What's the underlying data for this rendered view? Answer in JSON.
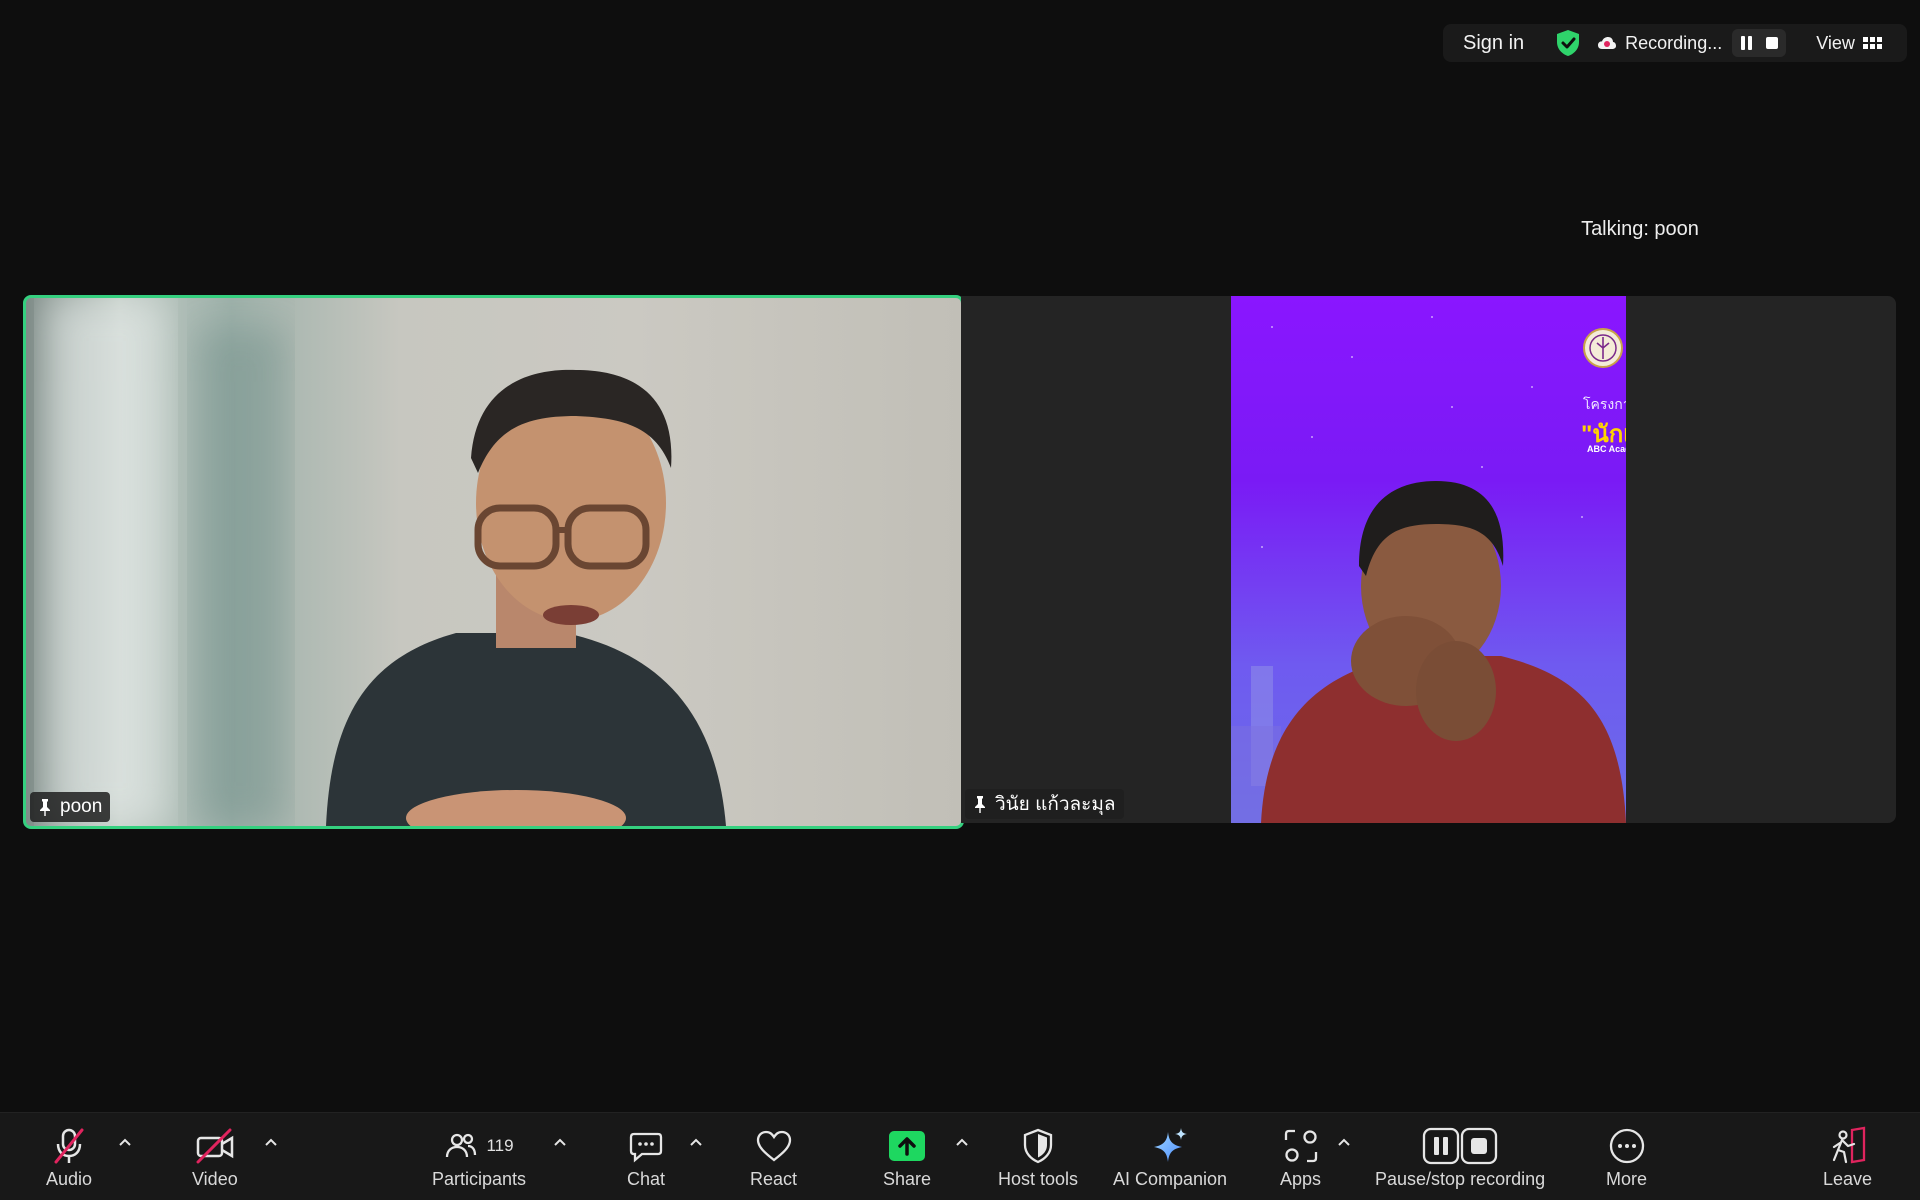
{
  "topbar": {
    "sign_in": "Sign in",
    "recording_label": "Recording...",
    "view_label": "View"
  },
  "talking": "Talking: poon",
  "participants_tiles": [
    {
      "name": "poon",
      "active_speaker": true
    },
    {
      "name": "วินัย แก้วละมุล",
      "active_speaker": false
    }
  ],
  "right_video_overlay": {
    "line1": "โครงกา",
    "line2": "\"นักเ",
    "line3": "ABC Acad"
  },
  "toolbar": {
    "audio": "Audio",
    "video": "Video",
    "participants": "Participants",
    "participant_count": "119",
    "chat": "Chat",
    "react": "React",
    "share": "Share",
    "host_tools": "Host tools",
    "ai_companion": "AI Companion",
    "apps": "Apps",
    "pause_stop": "Pause/stop recording",
    "more": "More",
    "leave": "Leave"
  },
  "colors": {
    "active_border": "#35d07f",
    "share_green": "#1ed760",
    "mute_red": "#e0245e",
    "shield_green": "#2fd36b"
  },
  "icons": [
    "shield-check-icon",
    "cloud-record-icon",
    "pause-icon",
    "stop-icon",
    "grid-icon",
    "pin-icon",
    "mic-muted-icon",
    "video-off-icon",
    "participants-icon",
    "chat-icon",
    "heart-icon",
    "share-arrow-icon",
    "host-shield-icon",
    "sparkle-icon",
    "apps-icon",
    "more-icon",
    "leave-icon"
  ]
}
